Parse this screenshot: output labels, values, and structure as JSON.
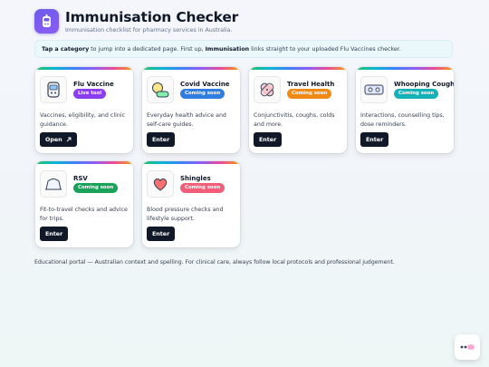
{
  "header": {
    "title": "Immunisation Checker",
    "subtitle": "Immunisation checklist for pharmacy services in Australia."
  },
  "banner": {
    "lead": "Tap a category",
    "text1": " to jump into a dedicated page. First up, ",
    "highlight": "Immunisation",
    "text2": " links straight to your uploaded Flu Vaccines checker."
  },
  "cards": [
    {
      "name": "Flu Vaccine",
      "badge": "Live tool",
      "badge_color": "#8b3ef0",
      "desc": "Vaccines, eligibility, and clinic guidance.",
      "button": "Open",
      "icon": "vaccine-device-icon"
    },
    {
      "name": "Covid Vaccine",
      "badge": "Coming soon",
      "badge_color": "#2f7de1",
      "desc": "Everyday health advice and self-care guides.",
      "button": "Enter",
      "icon": "capsule-chat-icon"
    },
    {
      "name": "Travel Health",
      "badge": "Coming soon",
      "badge_color": "#f08a14",
      "desc": "Conjunctivitis, coughs, colds and more.",
      "button": "Enter",
      "icon": "bandage-icon"
    },
    {
      "name": "Whooping Cough",
      "badge": "Coming soon",
      "badge_color": "#14b2b8",
      "desc": "Interactions, counselling tips, dose reminders.",
      "button": "Enter",
      "icon": "pill-strip-icon"
    },
    {
      "name": "RSV",
      "badge": "Coming soon",
      "badge_color": "#19a35a",
      "desc": "Fit-to-travel checks and advice for trips.",
      "button": "Enter",
      "icon": "bag-icon"
    },
    {
      "name": "Shingles",
      "badge": "Coming soon",
      "badge_color": "#f25d78",
      "desc": "Blood pressure checks and lifestyle support.",
      "button": "Enter",
      "icon": "heart-icon"
    }
  ],
  "footnote": "Educational portal — Australian context and spelling. For clinical care, always follow local protocols and professional judgement."
}
